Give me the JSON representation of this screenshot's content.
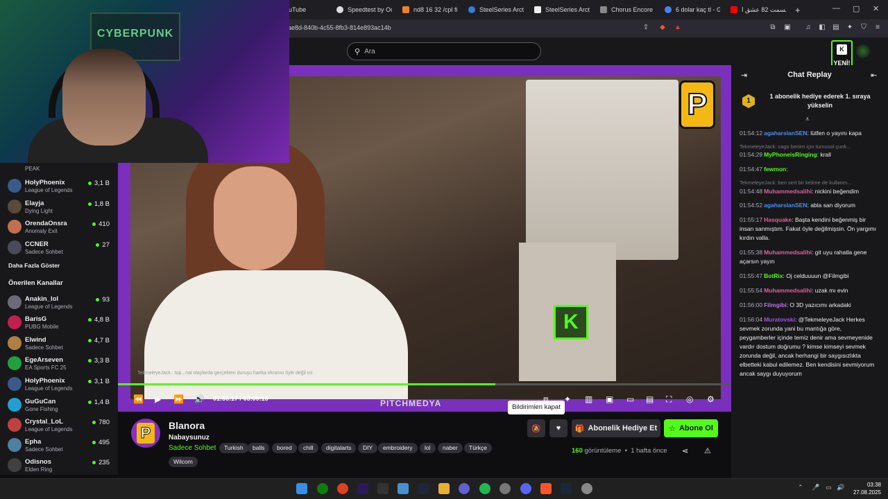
{
  "browser": {
    "tabs": [
      {
        "label": "uTube",
        "color": "#ff0000"
      },
      {
        "label": "Speedtest by Ookla",
        "color": "#dddddd"
      },
      {
        "label": "nd8 16 32 /cpl fil",
        "color": "#f08030"
      },
      {
        "label": "SteelSeries Arctis",
        "color": "#3a7bd5"
      },
      {
        "label": "SteelSeries Arctis",
        "color": "#eeeeee"
      },
      {
        "label": "Chorus Encore",
        "color": "#888888"
      },
      {
        "label": "6 dolar kaç tl - Go",
        "color": "#4285f4"
      },
      {
        "label": "قسمت 82 عشق ا",
        "color": "#ff0000"
      }
    ],
    "new_tab": "+",
    "url": "ae8d-840b-4c55-8fb3-814e893ac14b",
    "window_controls": {
      "minimize": "—",
      "maximize": "▢",
      "close": "✕"
    }
  },
  "header": {
    "search_placeholder": "Ara",
    "new_badge": "YENİ!"
  },
  "webcam": {
    "poster_text": "CYBERPUNK"
  },
  "sidebar": {
    "followed": [
      {
        "name": "",
        "game": "PEAK",
        "viewers": "",
        "color": "#5a5a5a"
      },
      {
        "name": "HolyPhoenix",
        "game": "League of Legends",
        "viewers": "3,1 B",
        "color": "#3a5a8a"
      },
      {
        "name": "Elayja",
        "game": "Dying Light",
        "viewers": "1,8 B",
        "color": "#5a4a3a"
      },
      {
        "name": "OrendaOnsra",
        "game": "Anomaly Exit",
        "viewers": "410",
        "color": "#c07050"
      },
      {
        "name": "CCNER",
        "game": "Sadece Sohbet",
        "viewers": "27",
        "color": "#4a4a5a"
      }
    ],
    "show_more": "Daha Fazla Göster",
    "recommended_title": "Önerilen Kanallar",
    "recommended": [
      {
        "name": "Anakin_lol",
        "game": "League of Legends",
        "viewers": "93",
        "color": "#6a6a7a"
      },
      {
        "name": "BarisG",
        "game": "PUBG Mobile",
        "viewers": "4,8 B",
        "color": "#c02050"
      },
      {
        "name": "Elwind",
        "game": "Sadece Sohbet",
        "viewers": "4,7 B",
        "color": "#b08040"
      },
      {
        "name": "EgeArseven",
        "game": "EA Sports FC 25",
        "viewers": "3,3 B",
        "color": "#20a040"
      },
      {
        "name": "HolyPhoenix",
        "game": "League of Legends",
        "viewers": "3,1 B",
        "color": "#3a5a8a"
      },
      {
        "name": "GuGuCan",
        "game": "Gone Fishing",
        "viewers": "1,4 B",
        "color": "#20a0d0"
      },
      {
        "name": "Crystal_LoL",
        "game": "League of Legends",
        "viewers": "780",
        "color": "#c04040"
      },
      {
        "name": "Epha",
        "game": "Sadece Sohbet",
        "viewers": "495",
        "color": "#5080a0"
      },
      {
        "name": "Odisnos",
        "game": "Elden Ring",
        "viewers": "235",
        "color": "#404040"
      }
    ]
  },
  "player": {
    "subtitle_overlay": "TekmeleyeJack : top...nal olaylarda gerçekten duruşu harika ekranın öyle değil mi",
    "watermark": "PITCHMEDYA",
    "time_current": "01:56:17",
    "time_separator": "/",
    "time_total": "03:09:15",
    "progress": 0.615,
    "tooltip": "Bildirimleri kapat"
  },
  "channel": {
    "name": "Blanora",
    "title": "Nabaysunuz",
    "category": "Sadece Sohbet",
    "tags": [
      "Turkish",
      "balls",
      "bored",
      "chill",
      "digitalarts",
      "DIY",
      "embroidery",
      "lol",
      "naber",
      "Türkçe",
      "Wilcom"
    ],
    "gift_button": "Abonelik Hediye Et",
    "subscribe_button": "Abone Ol",
    "views_count": "160",
    "views_label": "görüntüleme",
    "separator": "•",
    "time_ago": "1 hafta önce"
  },
  "chat": {
    "title": "Chat Replay",
    "pinned_rank": "1",
    "pinned_text": "1 abonelik hediye ederek 1. sıraya yükselin",
    "messages": [
      {
        "time": "01:54:12",
        "user": "agaharslanSEN",
        "color": "#4d8ef0",
        "text": "lütfen o yayını kapa"
      },
      {
        "reply": "TekmeleyeJack: cago benim için turnusol çunk..."
      },
      {
        "time": "01:54:29",
        "user": "MyPhoneisRinging",
        "color": "#53fc18",
        "text": "krall"
      },
      {
        "time": "01:54:47",
        "user": "fewmon",
        "color": "#53fc18",
        "text": ""
      },
      {
        "reply": "TekmeleyeJack: ben sert bir kelime de kullanm..."
      },
      {
        "time": "01:54:48",
        "user": "Muhammedsalihi",
        "color": "#e060a0",
        "text": "nickini beğendim"
      },
      {
        "time": "01:54:52",
        "user": "agaharslanSEN",
        "color": "#4d8ef0",
        "text": "abla san diyorum"
      },
      {
        "time": "01:55:17",
        "user": "Hasquake",
        "color": "#e060a0",
        "text": "Başta kendini beğenmiş bir insan sanmıştım. Fakat öyle değilmişsin. Ön yargımı kırdın valla."
      },
      {
        "time": "01:55:38",
        "user": "Muhammedsalihi",
        "color": "#e060a0",
        "text": "git uyu rahatla gene açarsın yayın"
      },
      {
        "time": "01:55:47",
        "user": "BotRix",
        "color": "#53fc18",
        "text": "Oj celduuuun @Filmgibi"
      },
      {
        "time": "01:55:54",
        "user": "Muhammedsalihi",
        "color": "#e060a0",
        "text": "uzak mı evin"
      },
      {
        "time": "01:56:00",
        "user": "Filmgibi",
        "color": "#c070f0",
        "text": "O 3D yazıcımı arkadaki"
      },
      {
        "time": "01:56:04",
        "user": "Muratovski",
        "color": "#a050e0",
        "text": "@TekmeleyeJack Herkes sevmek zorunda yani bu mantığa göre, peygamberler içinde temiz denir ama sevmeyenide vardır dostum doğrumu ? kimse kimseyi sevmek zorunda değil, ancak herhangi bir saygısızlıkta elbetteki kabul edilemez. Ben kendisini sevmiyorum ancak saygı duyuyorum"
      }
    ]
  },
  "taskbar": {
    "time": "03:38",
    "date": "27.08.2025"
  }
}
